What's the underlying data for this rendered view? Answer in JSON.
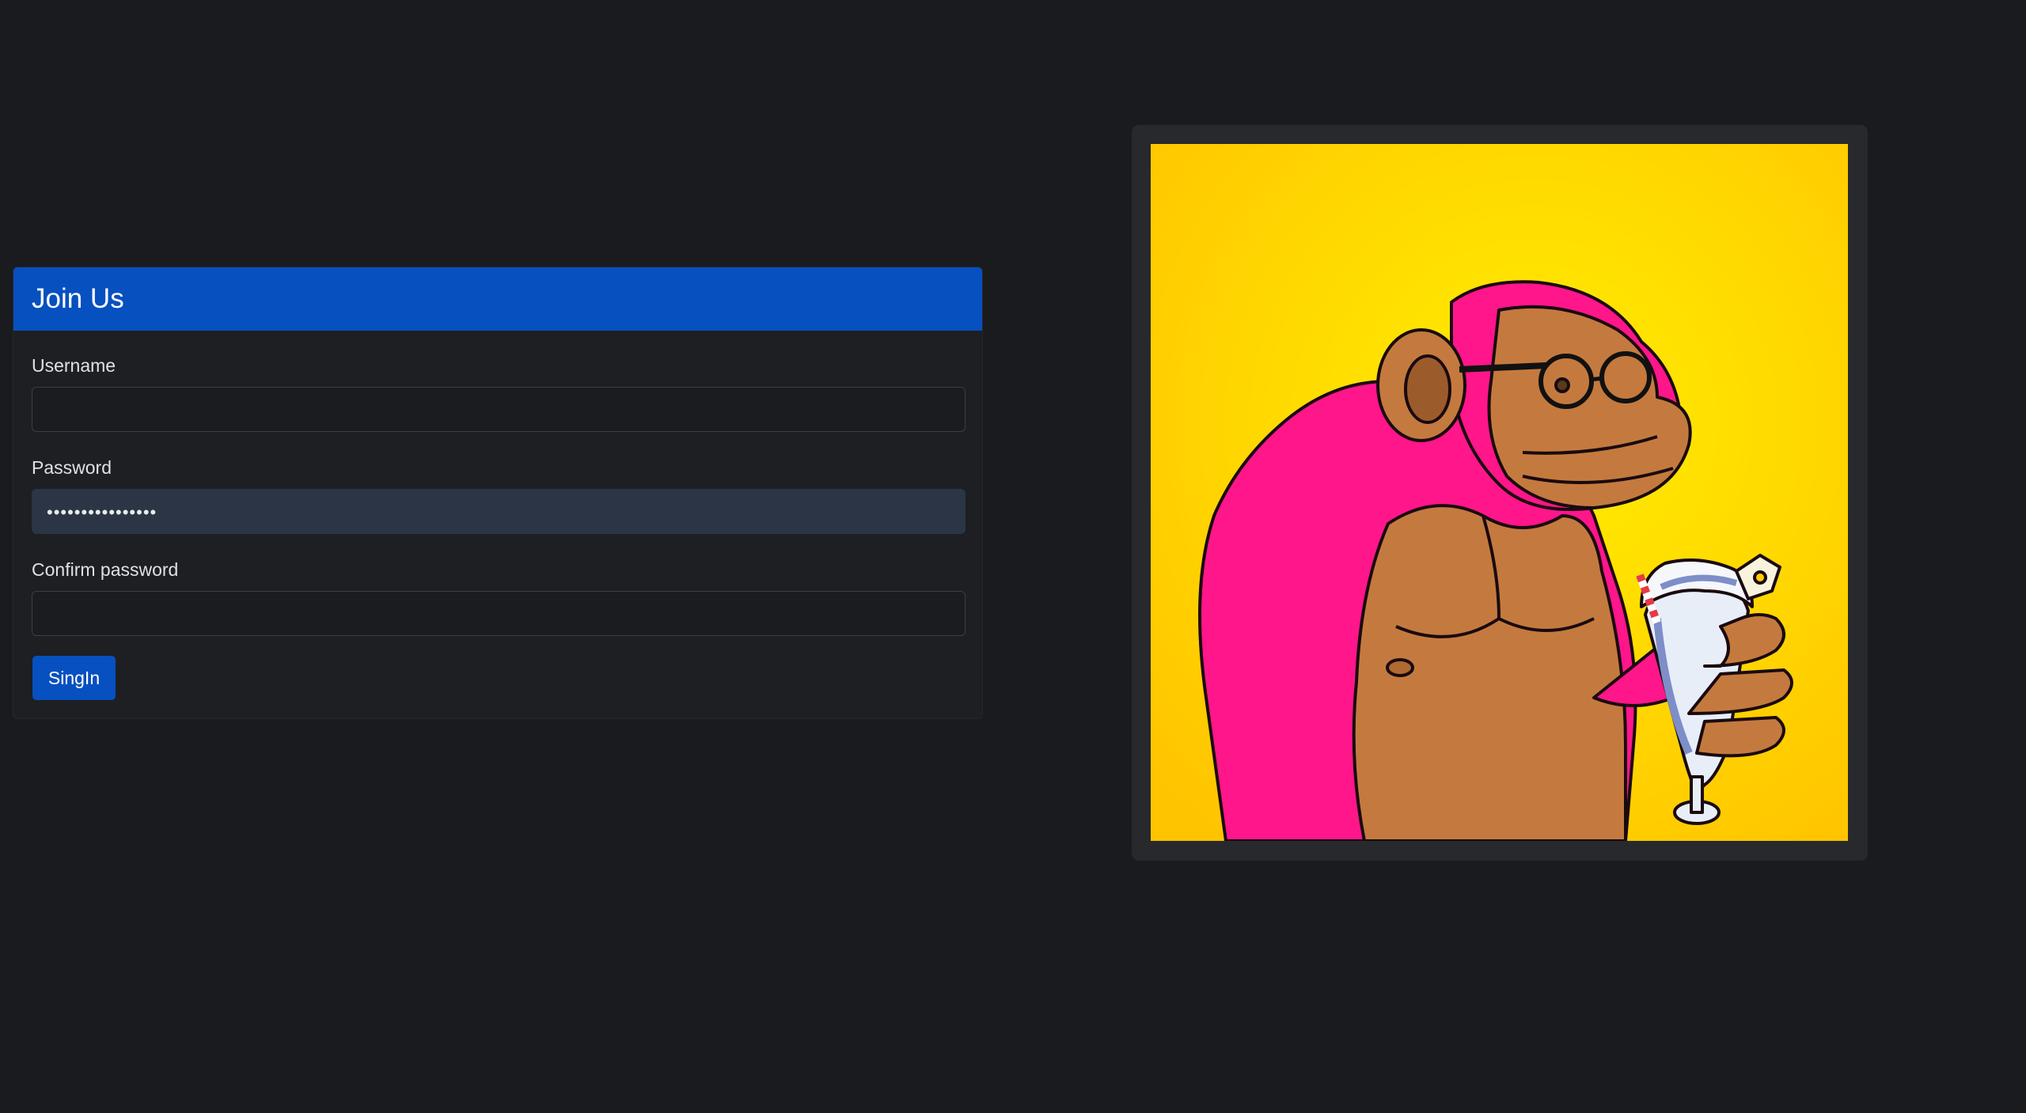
{
  "form": {
    "title": "Join Us",
    "fields": [
      {
        "label": "Username",
        "value": "",
        "type": "text"
      },
      {
        "label": "Password",
        "value": "••••••••••••••••",
        "type": "password"
      },
      {
        "label": "Confirm password",
        "value": "",
        "type": "password"
      }
    ],
    "submit_label": "SingIn"
  },
  "artwork": {
    "subject": "gorilla-with-glasses-and-milkshake",
    "alt": ""
  },
  "colors": {
    "page_background": "#1a1b1e",
    "accent": "#0650c0",
    "card_background": "#1d1f22",
    "filled_input_background": "#2b3546",
    "artwork_background": "#ffd700",
    "gorilla_fur": "#ff1a8c",
    "gorilla_skin": "#c47a3e"
  }
}
